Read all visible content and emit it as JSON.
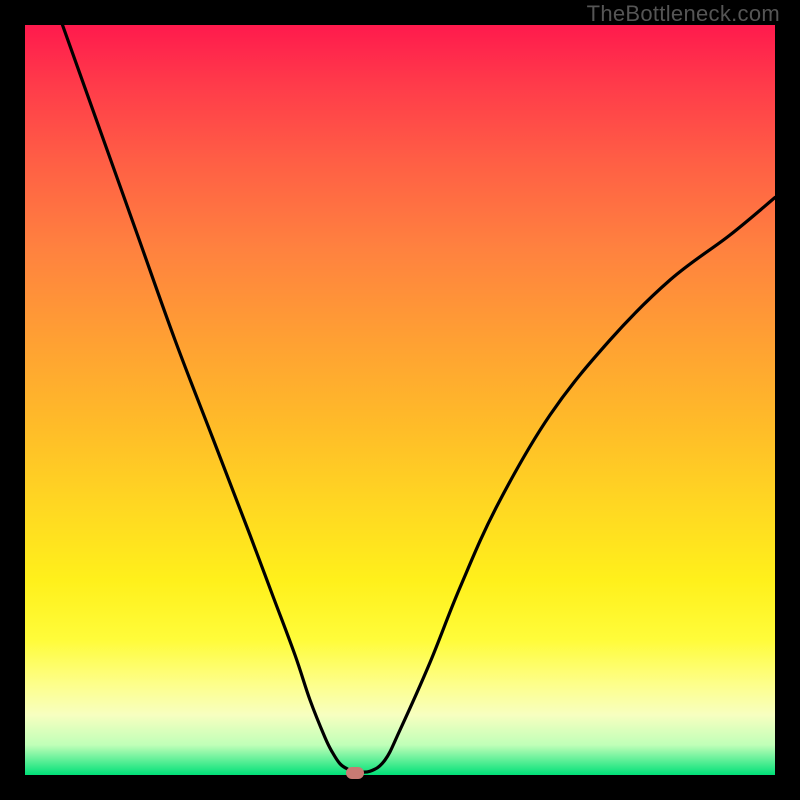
{
  "watermark": "TheBottleneck.com",
  "chart_data": {
    "type": "line",
    "title": "",
    "xlabel": "",
    "ylabel": "",
    "xlim": [
      0,
      100
    ],
    "ylim": [
      0,
      100
    ],
    "series": [
      {
        "name": "bottleneck-curve",
        "x": [
          5,
          10,
          15,
          20,
          25,
          30,
          33,
          36,
          38,
          40,
          41,
          42,
          43,
          44,
          46,
          48,
          50,
          54,
          58,
          63,
          70,
          78,
          86,
          94,
          100
        ],
        "values": [
          100,
          86,
          72,
          58,
          45,
          32,
          24,
          16,
          10,
          5,
          3,
          1.5,
          0.8,
          0.5,
          0.5,
          2,
          6,
          15,
          25,
          36,
          48,
          58,
          66,
          72,
          77
        ]
      }
    ],
    "annotations": [
      {
        "name": "optimal-point",
        "x": 44,
        "y": 0.3
      }
    ],
    "grid": false
  }
}
